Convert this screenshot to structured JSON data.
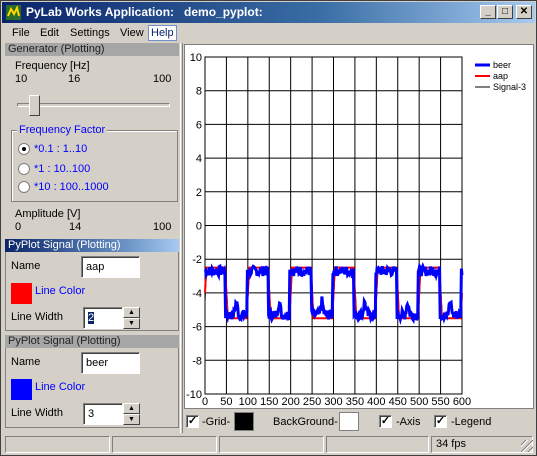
{
  "window": {
    "title": "PyLab Works Application:   demo_pyplot:",
    "minimize_glyph": "_",
    "maximize_glyph": "□",
    "close_glyph": "✕"
  },
  "menu": {
    "items": [
      "File",
      "Edit",
      "Settings",
      "View",
      "Help"
    ]
  },
  "generator": {
    "header": "Generator (Plotting)",
    "frequency_label": "Frequency [Hz]",
    "freq_ticks": [
      "10",
      "16",
      "100"
    ],
    "slider_value": 16,
    "freq_factor": {
      "title": "Frequency Factor",
      "options": [
        "*0.1 : 1..10",
        "*1 : 10..100",
        "*10 : 100..1000"
      ],
      "selected": 0
    },
    "amplitude_label": "Amplitude [V]",
    "amp_ticks": [
      "0",
      "14",
      "100"
    ]
  },
  "signal1": {
    "header": "PyPlot Signal (Plotting)",
    "name_label": "Name",
    "name_value": "aap",
    "color_label": "Line Color",
    "color": "#ff0000",
    "width_label": "Line Width",
    "width_value": "2"
  },
  "signal2": {
    "header": "PyPlot Signal (Plotting)",
    "name_label": "Name",
    "name_value": "beer",
    "color_label": "Line Color",
    "color": "#0000ff",
    "width_label": "Line Width",
    "width_value": "3"
  },
  "plot_controls": {
    "grid_label": "-Grid-",
    "background_label": "BackGround-",
    "axis_label": "-Axis",
    "legend_label": "-Legend",
    "check_glyph": "✓"
  },
  "status": {
    "fps": "34 fps"
  },
  "chart_data": {
    "type": "line",
    "xlim": [
      0,
      600
    ],
    "ylim": [
      -10,
      10
    ],
    "xticks": [
      0,
      50,
      100,
      150,
      200,
      250,
      300,
      350,
      400,
      450,
      500,
      550,
      600
    ],
    "yticks": [
      -10,
      -8,
      -6,
      -4,
      -2,
      0,
      2,
      4,
      6,
      8,
      10
    ],
    "grid": true,
    "legend_position": "top-right",
    "series": [
      {
        "name": "beer",
        "color": "#0000ff",
        "width": 3,
        "kind": "noisy-square",
        "high": -2.7,
        "low": -5.3,
        "period": 100
      },
      {
        "name": "aap",
        "color": "#ff0000",
        "width": 2,
        "kind": "square",
        "high": -2.5,
        "low": -5.5,
        "period": 100
      },
      {
        "name": "Signal-3",
        "color": "#000000",
        "width": 1,
        "kind": "square",
        "high": -2.5,
        "low": -5.5,
        "period": 100
      }
    ]
  }
}
